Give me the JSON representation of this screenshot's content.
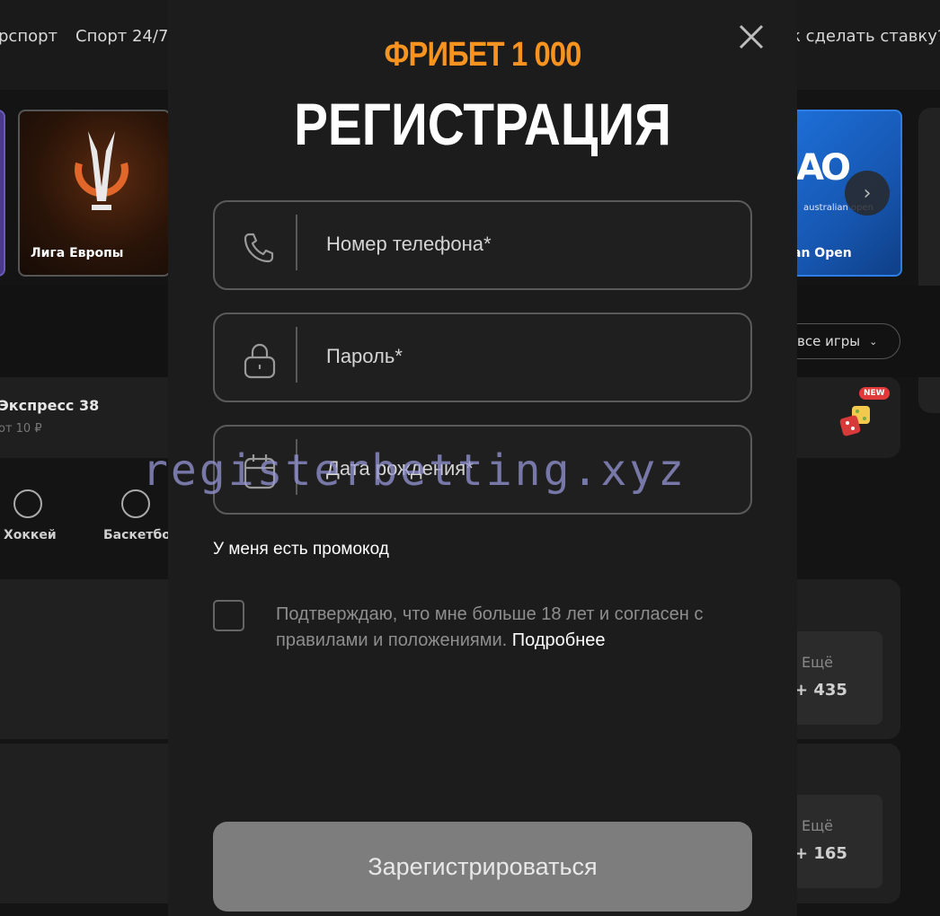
{
  "background": {
    "nav": [
      "рспорт",
      "Спорт 24/7",
      "к сделать ставку?"
    ],
    "cards": [
      {
        "label": "Лига Европы"
      },
      {
        "label": "an Open",
        "logo_text": "AO",
        "logo_sub": "australian open"
      }
    ],
    "all_games_label": "все игры",
    "express": {
      "title": "Экспресс 38",
      "sub": "от 10 ₽"
    },
    "new_badge": "NEW",
    "sports": [
      "Хоккей",
      "Баскетбол"
    ],
    "more_label": "Ещё",
    "more_counts": [
      "+ 435",
      "+ 165"
    ]
  },
  "modal": {
    "promo_title": "ФРИБЕТ 1 000",
    "title": "РЕГИСТРАЦИЯ",
    "fields": [
      {
        "placeholder": "Номер телефона*",
        "icon": "phone-icon"
      },
      {
        "placeholder": "Пароль*",
        "icon": "lock-icon"
      },
      {
        "placeholder": "Дата рождения*",
        "icon": "calendar-icon"
      }
    ],
    "promo_link": "У меня есть промокод",
    "consent_text": "Подтверждаю, что мне больше 18 лет и согласен с правилами и положениями.",
    "consent_link": "Подробнее",
    "submit_label": "Зарегистрироваться"
  },
  "watermark": "registerbetting.xyz",
  "colors": {
    "accent_orange": "#f7931e",
    "modal_bg": "#1c1c1c",
    "field_border": "#5a5a5a",
    "submit_bg": "#7d7d7d"
  }
}
